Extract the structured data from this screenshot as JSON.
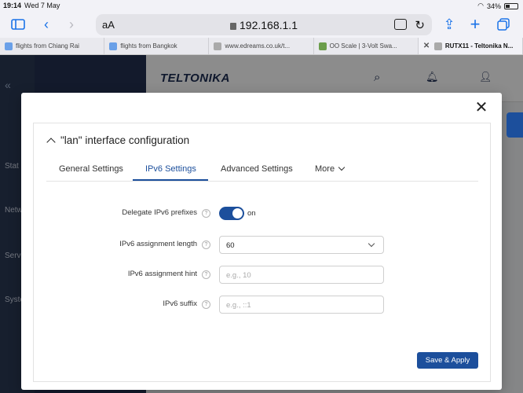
{
  "status": {
    "time": "19:14",
    "date": "Wed 7 May",
    "battery": "34%"
  },
  "browser": {
    "text_size": "aA",
    "url": "192.168.1.1",
    "tabs": [
      {
        "label": "flights from Chiang Rai"
      },
      {
        "label": "flights from Bangkok"
      },
      {
        "label": "www.edreams.co.uk/t..."
      },
      {
        "label": "OO Scale | 3-Volt Swa..."
      },
      {
        "label": "RUTX11 - Teltonika N..."
      }
    ]
  },
  "app": {
    "logo": "TELTONIKA",
    "sidebar_labels": [
      "Stat",
      "Netw",
      "Serv",
      "Syste"
    ]
  },
  "modal": {
    "close_glyph": "✕",
    "section_title": "\"lan\" interface configuration",
    "tabs": [
      {
        "label": "General Settings"
      },
      {
        "label": "IPv6 Settings"
      },
      {
        "label": "Advanced Settings"
      },
      {
        "label": "More"
      }
    ],
    "fields": {
      "delegate": {
        "label": "Delegate IPv6 prefixes",
        "state": "on"
      },
      "assignment_length": {
        "label": "IPv6 assignment length",
        "value": "60"
      },
      "assignment_hint": {
        "label": "IPv6 assignment hint",
        "placeholder": "e.g., 10"
      },
      "suffix": {
        "label": "IPv6 suffix",
        "placeholder": "e.g., ::1"
      }
    },
    "help_glyph": "?",
    "apply_label": "Save & Apply"
  }
}
